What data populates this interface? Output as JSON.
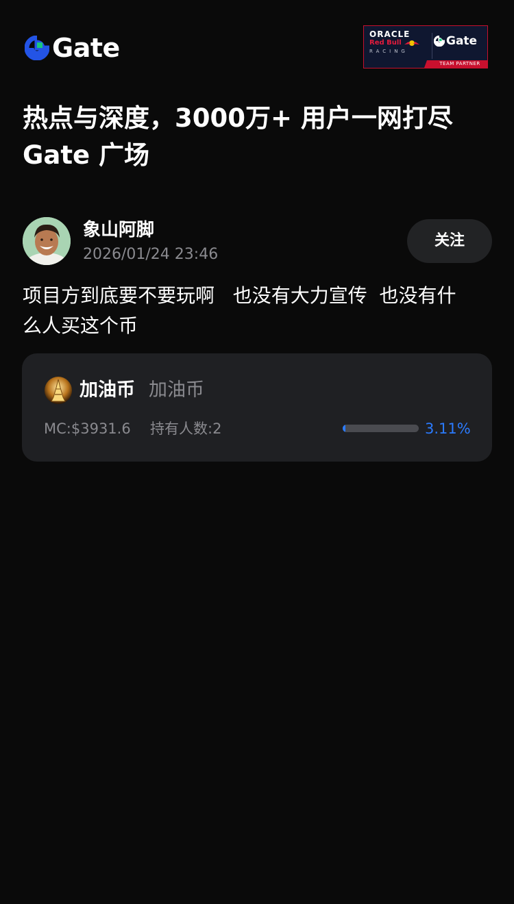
{
  "header": {
    "logo_text": "Gate",
    "brand_color": "#2354e6",
    "accent_color": "#18c77f",
    "partner_banner": {
      "line1": "ORACLE",
      "line2": "Red Bull",
      "line3": "RACING",
      "gate_text": "Gate",
      "strip_text": "TEAM PARTNER"
    }
  },
  "headline": {
    "line1": "热点与深度，3000万+ 用户一网打尽",
    "line2": "Gate 广场"
  },
  "post": {
    "author_name": "象山阿脚",
    "timestamp": "2026/01/24 23:46",
    "follow_label": "关注",
    "body_line1": "项目方到底要不要玩啊   也没有大力宣传  也没有什",
    "body_line2": "么人买这个币"
  },
  "token_card": {
    "name": "加油币",
    "subname": "加油币",
    "market_cap": "MC:$3931.6",
    "holders": "持有人数:2",
    "progress_percent_label": "3.11%",
    "progress_fraction": 0.0311,
    "progress_color": "#2b7bff",
    "icon": "tower-icon"
  }
}
